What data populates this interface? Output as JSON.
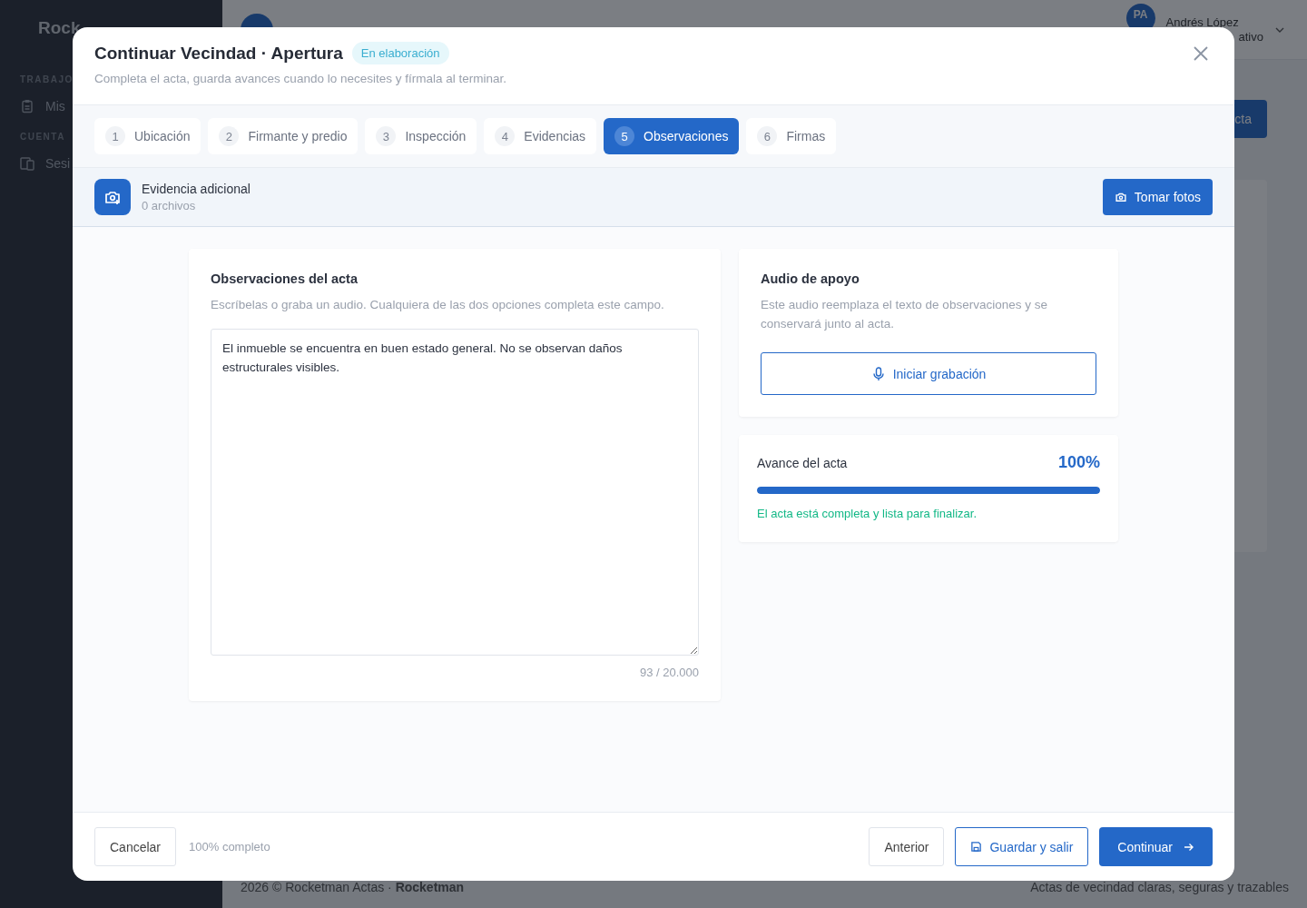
{
  "background": {
    "brand": "Rock",
    "sections": [
      {
        "label": "TRABAJO",
        "items": [
          {
            "label": "Mis",
            "kind": "clipboard"
          }
        ]
      },
      {
        "label": "CUENTA",
        "items": [
          {
            "label": "Sesi",
            "kind": "devices"
          }
        ]
      }
    ],
    "user": {
      "initials": "PA",
      "name": "Andrés López",
      "role": "ativo"
    },
    "action_button": "cta",
    "footer": {
      "left": "2026 © Rocketman Actas · **Rocketman**",
      "right": "Actas de vecindad claras, seguras y trazables"
    }
  },
  "dialog": {
    "title": "Continuar Vecindad · Apertura",
    "status": "En elaboración",
    "subtitle": "Completa el acta, guarda avances cuando lo necesites y fírmala al terminar.",
    "steps": [
      {
        "number": "1",
        "label": "Ubicación",
        "selected": false
      },
      {
        "number": "2",
        "label": "Firmante y predio",
        "selected": false
      },
      {
        "number": "3",
        "label": "Inspección",
        "selected": false
      },
      {
        "number": "4",
        "label": "Evidencias",
        "selected": false
      },
      {
        "number": "5",
        "label": "Observaciones",
        "selected": true
      },
      {
        "number": "6",
        "label": "Firmas",
        "selected": false
      }
    ],
    "evidence": {
      "title": "Evidencia adicional",
      "count": "0 archivos",
      "button": "Tomar fotos"
    },
    "observations": {
      "title": "Observaciones del acta",
      "hint": "Escríbelas o graba un audio. Cualquiera de las dos opciones completa este campo.",
      "value": "El inmueble se encuentra en buen estado general. No se observan daños estructurales visibles.",
      "counter": "93 / 20.000"
    },
    "audio": {
      "title": "Audio de apoyo",
      "hint": "Este audio reemplaza el texto de observaciones y se conservará junto al acta.",
      "button": "Iniciar grabación"
    },
    "progress": {
      "label": "Avance del acta",
      "percent": "100%",
      "level": 1,
      "message": "El acta está completa y lista para finalizar."
    },
    "footer": {
      "cancel": "Cancelar",
      "completion": "100% completo",
      "previous": "Anterior",
      "save": "Guardar y salir",
      "continue": "Continuar"
    }
  }
}
